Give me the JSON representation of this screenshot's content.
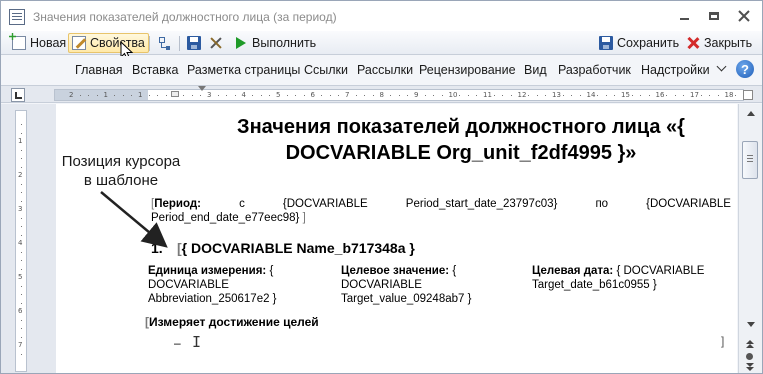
{
  "window": {
    "title": "Значения показателей должностного лица (за период)"
  },
  "toolbar": {
    "new_label": "Новая",
    "properties_label": "Свойства",
    "run_label": "Выполнить",
    "save_label": "Сохранить",
    "close_label": "Закрыть"
  },
  "ribbon": {
    "tabs": [
      "Главная",
      "Вставка",
      "Разметка страницы",
      "Ссылки",
      "Рассылки",
      "Рецензирование",
      "Вид",
      "Разработчик",
      "Надстройки"
    ]
  },
  "ruler": {
    "ticks": [
      "2",
      "1",
      "1",
      "2",
      "3",
      "4",
      "5",
      "6",
      "7",
      "8",
      "9",
      "10",
      "11",
      "12",
      "13",
      "14",
      "15",
      "16",
      "17",
      "18"
    ],
    "vticks": [
      "1",
      "2",
      "3",
      "4",
      "5",
      "6",
      "7"
    ]
  },
  "document": {
    "title_line1": "Значения показателей должностного лица «{",
    "title_line2": "DOCVARIABLE Org_unit_f2df4995 }»",
    "period_label": "Период:",
    "period_c": "с",
    "period_start_open": "{DOCVARIABLE",
    "period_start_var": "Period_start_date_23797c03}",
    "period_to": "по",
    "period_end_open": "{DOCVARIABLE",
    "period_end_var": "Period_end_date_e77eec98}",
    "heading_number": "1.",
    "heading_text": "{ DOCVARIABLE Name_b717348a }",
    "unit_label": "Единица измерения:",
    "unit_line1": "{",
    "unit_line2": "DOCVARIABLE",
    "unit_line3": "Abbreviation_250617e2 }",
    "target_label": "Целевое значение:",
    "target_line1": "{",
    "target_line2": "DOCVARIABLE",
    "target_line3": "Target_value_09248ab7 }",
    "date_label": "Целевая дата:",
    "date_line1": "{ DOCVARIABLE",
    "date_line2": "Target_date_b61c0955 }",
    "section_label": "Измеряет достижение целей",
    "dash": "–"
  },
  "annotation": {
    "line1": "Позиция курсора",
    "line2": "в шаблоне"
  },
  "colors": {
    "accent_blue": "#2c5aa0",
    "run_green": "#1e9a28",
    "close_red": "#d32a2a",
    "hover_yellow": "#ffe9a8"
  }
}
